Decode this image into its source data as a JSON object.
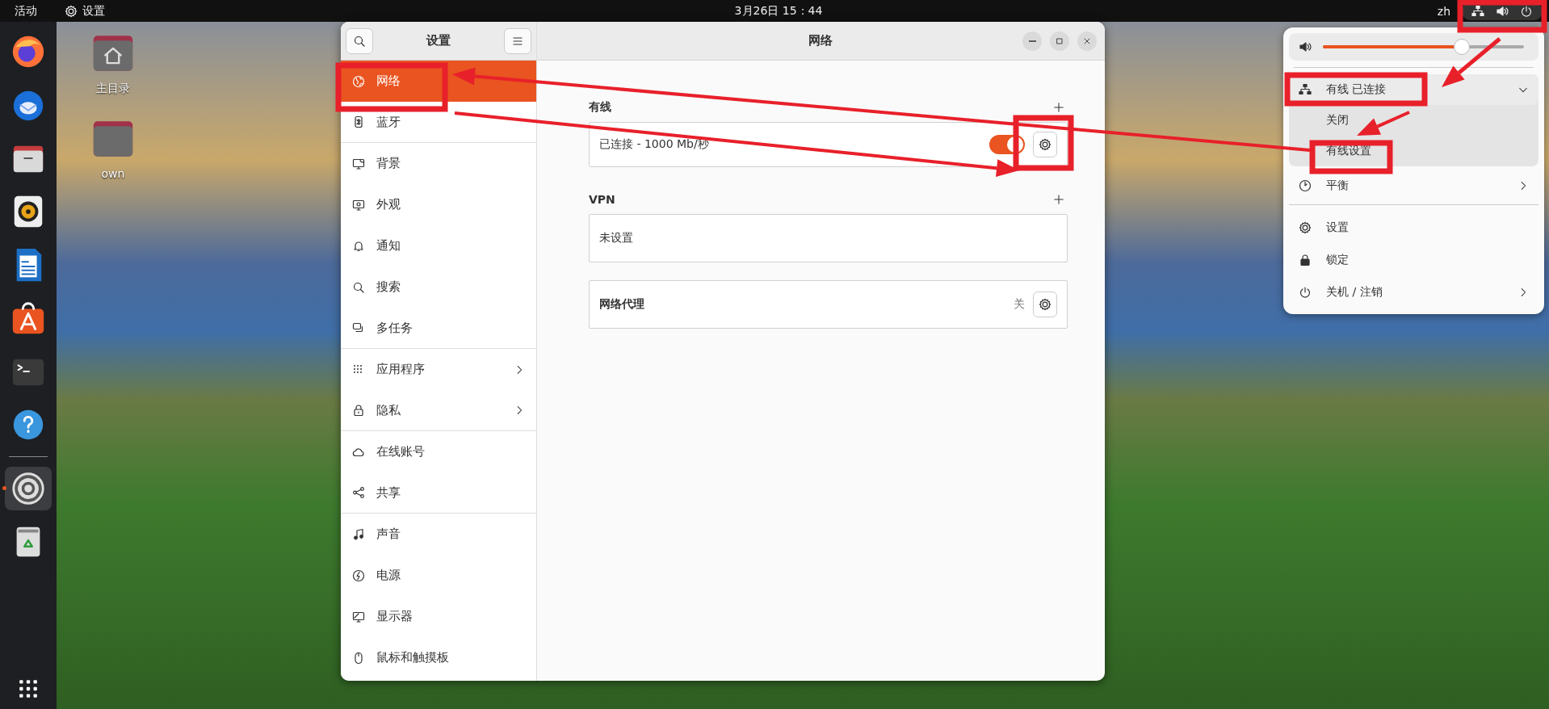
{
  "top_bar": {
    "activities": "活动",
    "app_menu": "设置",
    "clock": "3月26日 15：44",
    "input_source": "zh"
  },
  "dock": {
    "items": [
      {
        "kind": "firefox",
        "running": false
      },
      {
        "kind": "thunderbird",
        "running": false
      },
      {
        "kind": "files",
        "running": false
      },
      {
        "kind": "speaker",
        "running": false
      },
      {
        "kind": "writer",
        "running": false
      },
      {
        "kind": "software",
        "running": false
      },
      {
        "kind": "terminal",
        "running": false
      },
      {
        "kind": "help",
        "running": false
      },
      {
        "kind": "settings",
        "running": true
      },
      {
        "kind": "trash",
        "running": false
      }
    ]
  },
  "desktop": {
    "icons": [
      {
        "kind": "home",
        "label": "主目录"
      },
      {
        "kind": "folder",
        "label": "own"
      }
    ]
  },
  "settings_window": {
    "sidebar_title": "设置",
    "title": "网络",
    "sidebar_items": [
      {
        "kind": "network",
        "label": "网络",
        "selected": true,
        "submenu": false,
        "divider_after": false
      },
      {
        "kind": "bluetooth",
        "label": "蓝牙",
        "selected": false,
        "submenu": false,
        "divider_after": true
      },
      {
        "kind": "background",
        "label": "背景",
        "selected": false,
        "submenu": false,
        "divider_after": false
      },
      {
        "kind": "appearance",
        "label": "外观",
        "selected": false,
        "submenu": false,
        "divider_after": false
      },
      {
        "kind": "notifications",
        "label": "通知",
        "selected": false,
        "submenu": false,
        "divider_after": false
      },
      {
        "kind": "search",
        "label": "搜索",
        "selected": false,
        "submenu": false,
        "divider_after": false
      },
      {
        "kind": "multitasking",
        "label": "多任务",
        "selected": false,
        "submenu": false,
        "divider_after": true
      },
      {
        "kind": "apps",
        "label": "应用程序",
        "selected": false,
        "submenu": true,
        "divider_after": false
      },
      {
        "kind": "privacy",
        "label": "隐私",
        "selected": false,
        "submenu": true,
        "divider_after": true
      },
      {
        "kind": "online-accounts",
        "label": "在线账号",
        "selected": false,
        "submenu": false,
        "divider_after": false
      },
      {
        "kind": "sharing",
        "label": "共享",
        "selected": false,
        "submenu": false,
        "divider_after": true
      },
      {
        "kind": "sound",
        "label": "声音",
        "selected": false,
        "submenu": false,
        "divider_after": false
      },
      {
        "kind": "power",
        "label": "电源",
        "selected": false,
        "submenu": false,
        "divider_after": false
      },
      {
        "kind": "displays",
        "label": "显示器",
        "selected": false,
        "submenu": false,
        "divider_after": false
      },
      {
        "kind": "mouse",
        "label": "鼠标和触摸板",
        "selected": false,
        "submenu": false,
        "divider_after": false
      }
    ],
    "sections": [
      {
        "heading": "有线",
        "add": true,
        "rows": [
          {
            "kind": "toggle",
            "label": "已连接 - 1000 Mb/秒",
            "on": true
          }
        ]
      },
      {
        "heading": "VPN",
        "add": true,
        "rows": [
          {
            "kind": "plain",
            "label": "未设置"
          }
        ]
      },
      {
        "add": false,
        "rows": [
          {
            "kind": "status",
            "label": "网络代理",
            "status": "关"
          }
        ]
      }
    ]
  },
  "system_menu": {
    "volume": {
      "level": 0.69
    },
    "wired": {
      "label": "有线 已连接",
      "expanded": true,
      "items": [
        "关闭",
        "有线设置"
      ]
    },
    "items": [
      {
        "kind": "power-mode",
        "label": "平衡",
        "submenu": true,
        "divider_after": true
      },
      {
        "kind": "settings",
        "label": "设置",
        "submenu": false,
        "divider_after": false
      },
      {
        "kind": "lock",
        "label": "锁定",
        "submenu": false,
        "divider_after": false
      },
      {
        "kind": "power",
        "label": "关机 / 注销",
        "submenu": true,
        "divider_after": false
      }
    ]
  }
}
